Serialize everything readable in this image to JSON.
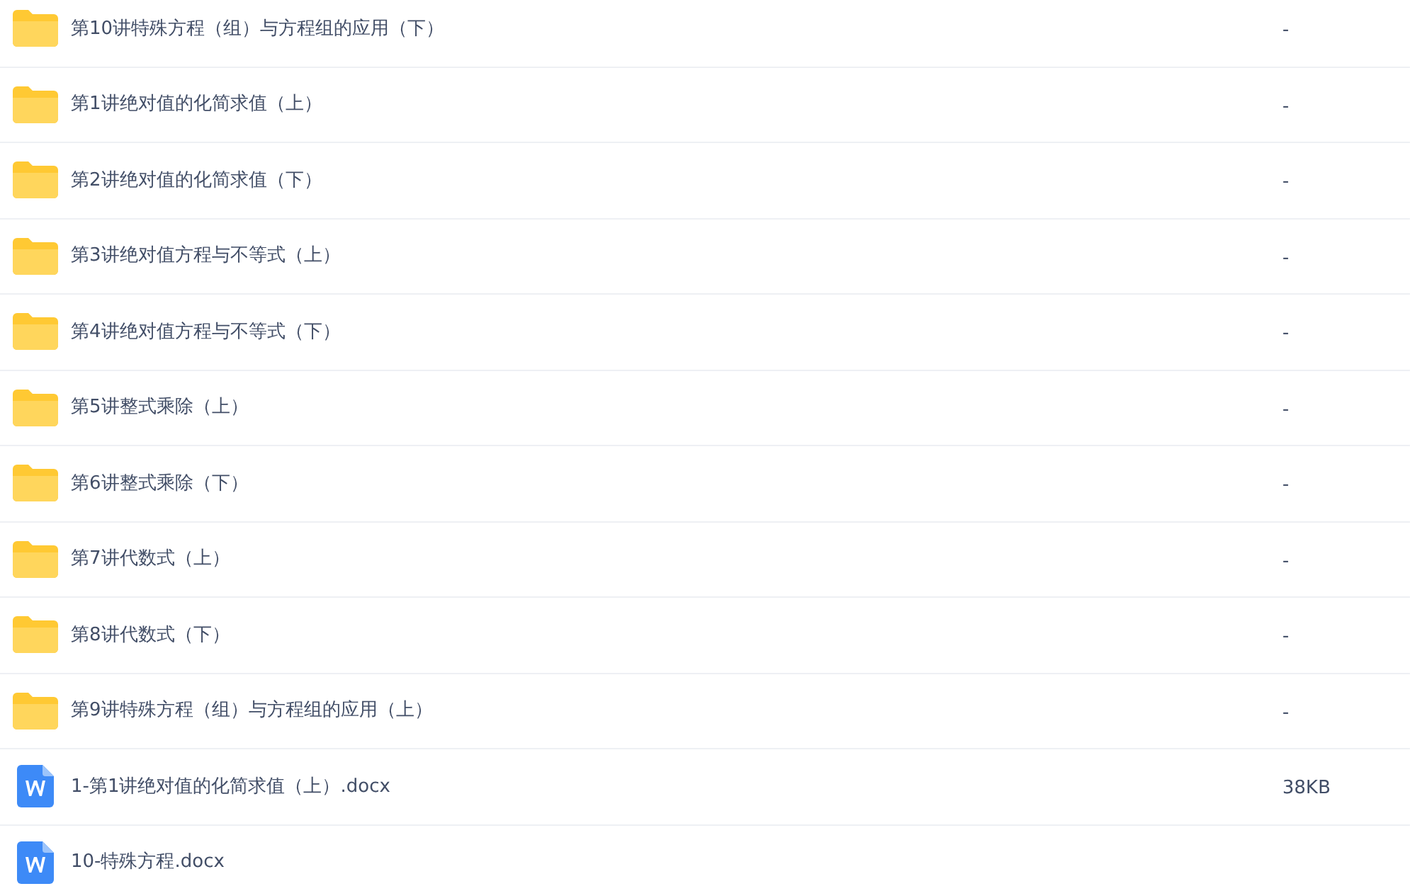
{
  "files": [
    {
      "kind": "folder",
      "name": "第10讲特殊方程（组）与方程组的应用（下）",
      "size": "-"
    },
    {
      "kind": "folder",
      "name": "第1讲绝对值的化简求值（上）",
      "size": "-"
    },
    {
      "kind": "folder",
      "name": "第2讲绝对值的化简求值（下）",
      "size": "-"
    },
    {
      "kind": "folder",
      "name": "第3讲绝对值方程与不等式（上）",
      "size": "-"
    },
    {
      "kind": "folder",
      "name": "第4讲绝对值方程与不等式（下）",
      "size": "-"
    },
    {
      "kind": "folder",
      "name": "第5讲整式乘除（上）",
      "size": "-"
    },
    {
      "kind": "folder",
      "name": "第6讲整式乘除（下）",
      "size": "-"
    },
    {
      "kind": "folder",
      "name": "第7讲代数式（上）",
      "size": "-"
    },
    {
      "kind": "folder",
      "name": "第8讲代数式（下）",
      "size": "-"
    },
    {
      "kind": "folder",
      "name": "第9讲特殊方程（组）与方程组的应用（上）",
      "size": "-"
    },
    {
      "kind": "docx",
      "name": "1-第1讲绝对值的化简求值（上）.docx",
      "size": "38KB"
    },
    {
      "kind": "docx",
      "name": "10-特殊方程.docx"
    }
  ]
}
